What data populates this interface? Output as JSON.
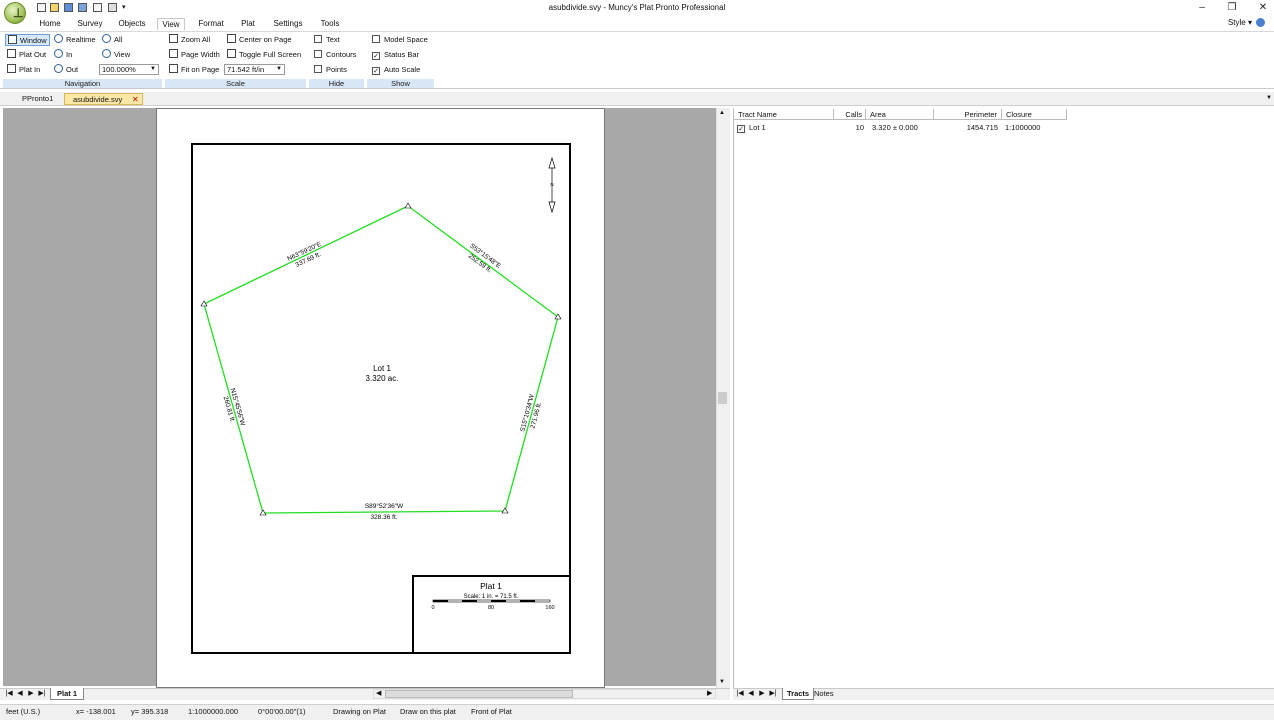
{
  "window": {
    "title": "asubdivide.svy - Muncy's Plat Pronto Professional",
    "minimize": "–",
    "restore": "❐",
    "close": "✕"
  },
  "menu": {
    "tabs": [
      "Home",
      "Survey",
      "Objects",
      "View",
      "Format",
      "Plat",
      "Settings",
      "Tools"
    ],
    "style_label": "Style",
    "style_arrow": "▾"
  },
  "ribbon": {
    "navigation": {
      "label": "Navigation",
      "window": "Window",
      "realtime": "Realtime",
      "all": "All",
      "plat_out": "Plat Out",
      "in": "In",
      "view": "View",
      "plat_in": "Plat In",
      "out": "Out",
      "zoom_value": "100.000%"
    },
    "scale": {
      "label": "Scale",
      "zoom_all": "Zoom All",
      "center_on_page": "Center on Page",
      "page_width": "Page Width",
      "toggle_full_screen": "Toggle Full Screen",
      "fit_on_page": "Fit on Page",
      "scale_value": "71.542 ft/in"
    },
    "hide": {
      "label": "Hide",
      "text": "Text",
      "contours": "Contours",
      "points": "Points"
    },
    "show": {
      "label": "Show",
      "model_space": "Model Space",
      "status_bar": "Status Bar",
      "auto_scale": "Auto Scale",
      "model_space_checked": false,
      "status_bar_checked": true,
      "auto_scale_checked": true
    }
  },
  "doc_tabs": [
    "PPronto1",
    "asubdivide.svy"
  ],
  "doc_tab_close": "✕",
  "plat": {
    "lot_name": "Lot 1",
    "lot_area": "3.320 ac.",
    "north": "N",
    "calls": [
      {
        "bearing": "N63°59'20\"E",
        "distance": "337.69 ft."
      },
      {
        "bearing": "S53°15'48\"E",
        "distance": "252.59 ft."
      },
      {
        "bearing": "S15°10'34\"W",
        "distance": "271.96 ft."
      },
      {
        "bearing": "S89°52'36\"W",
        "distance": "328.36 ft."
      },
      {
        "bearing": "N15°45'56\"W",
        "distance": "260.81 ft."
      }
    ],
    "title_block": {
      "title": "Plat 1",
      "scale_text": "Scale: 1 in. = 71.5 ft.",
      "ticks": [
        "0",
        "80",
        "160"
      ]
    }
  },
  "sheet_tab": "Plat 1",
  "nav_buttons": [
    "|◀",
    "◀",
    "▶",
    "▶|"
  ],
  "hscroll_left": "◀",
  "hscroll_right": "▶",
  "vscroll_up": "▲",
  "vscroll_down": "▼",
  "tracts": {
    "columns": [
      "Tract Name",
      "Calls",
      "Area",
      "Perimeter",
      "Closure"
    ],
    "rows": [
      {
        "name": "Lot 1",
        "calls": "10",
        "area": "3.320 ± 0.000",
        "perimeter": "1454.715",
        "closure": "1:1000000",
        "checked": true
      }
    ],
    "tabs": [
      "Tracts",
      "Notes"
    ]
  },
  "status": {
    "units": "feet (U.S.)",
    "x": "x= -138.001",
    "y": "y= 395.318",
    "ratio": "1:1000000.000",
    "angle": "0°00'00.00\"(1)",
    "mode1": "Drawing on Plat",
    "mode2": "Draw on this plat",
    "mode3": "Front of Plat"
  },
  "colors": {
    "lot_line": "#22dd22",
    "selected_tab": "#fbe7a6",
    "group_label_bg": "#d9e6f5"
  }
}
